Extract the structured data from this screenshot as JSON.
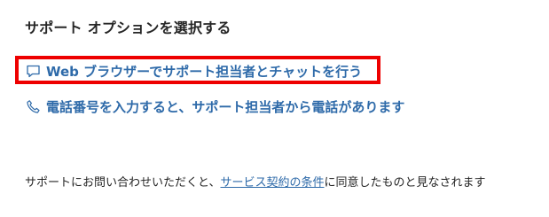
{
  "title": "サポート オプションを選択する",
  "options": {
    "chat": {
      "icon": "chat-bubble-icon",
      "label": "Web ブラウザーでサポート担当者とチャットを行う"
    },
    "phone": {
      "icon": "phone-icon",
      "label": "電話番号を入力すると、サポート担当者から電話があります"
    }
  },
  "footer": {
    "prefix": "サポートにお問い合わせいただくと、",
    "link": "サービス契約の条件",
    "suffix": "に同意したものと見なされます"
  },
  "colors": {
    "link": "#2e6aa9",
    "highlight": "#ee0000"
  }
}
